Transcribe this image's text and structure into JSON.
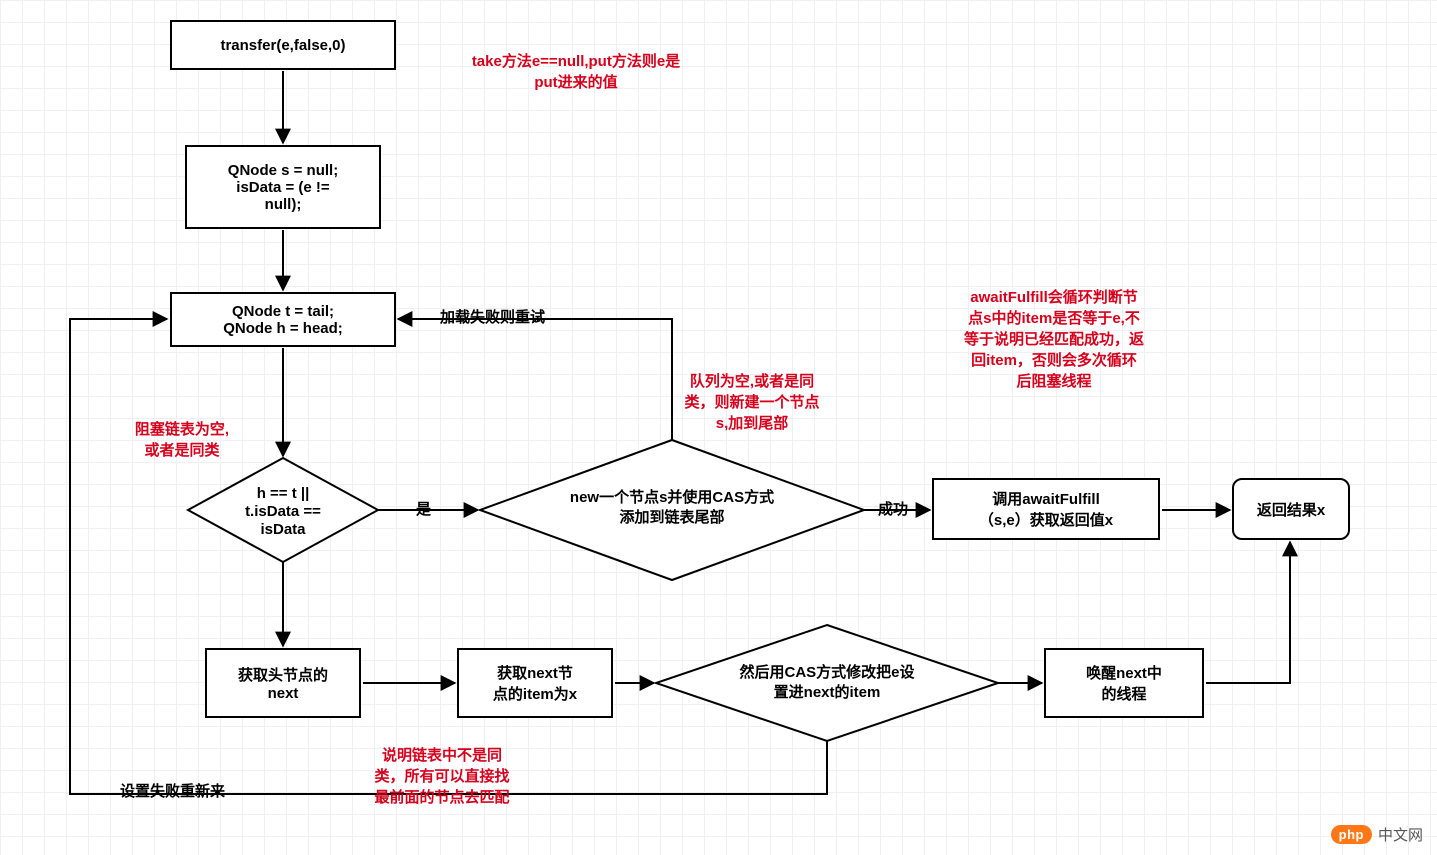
{
  "chart_data": {
    "type": "flowchart",
    "title": "",
    "nodes": [
      {
        "id": "n_start",
        "shape": "rect",
        "text": "transfer(e,false,0)"
      },
      {
        "id": "n_init",
        "shape": "rect",
        "text": "QNode s = null;\nisData = (e !=\nnull);"
      },
      {
        "id": "n_loop",
        "shape": "rect",
        "text": "QNode t = tail;\nQNode h = head;"
      },
      {
        "id": "d_cond",
        "shape": "diamond",
        "text": "h == t ||\nt.isData ==\nisData"
      },
      {
        "id": "d_new",
        "shape": "diamond",
        "text": "new一个节点s并使用CAS方式\n添加到链表尾部"
      },
      {
        "id": "n_await",
        "shape": "rect",
        "text": "调用awaitFulfill\n（s,e）获取返回值x"
      },
      {
        "id": "n_return",
        "shape": "round",
        "text": "返回结果x"
      },
      {
        "id": "n_gethead",
        "shape": "rect",
        "text": "获取头节点的\nnext"
      },
      {
        "id": "n_getitem",
        "shape": "rect",
        "text": "获取next节\n点的item为x"
      },
      {
        "id": "d_casset",
        "shape": "diamond",
        "text": "然后用CAS方式修改把e设\n置进next的item"
      },
      {
        "id": "n_wake",
        "shape": "rect",
        "text": "唤醒next中\n的线程"
      }
    ],
    "edges": [
      {
        "from": "n_start",
        "to": "n_init",
        "label": ""
      },
      {
        "from": "n_init",
        "to": "n_loop",
        "label": ""
      },
      {
        "from": "n_loop",
        "to": "d_cond",
        "label": ""
      },
      {
        "from": "d_cond",
        "to": "d_new",
        "label": "是"
      },
      {
        "from": "d_new",
        "to": "n_await",
        "label": "成功"
      },
      {
        "from": "n_await",
        "to": "n_return",
        "label": ""
      },
      {
        "from": "d_new",
        "to": "n_loop",
        "label": "加载失败则重试"
      },
      {
        "from": "d_cond",
        "to": "n_gethead",
        "label": ""
      },
      {
        "from": "n_gethead",
        "to": "n_getitem",
        "label": ""
      },
      {
        "from": "n_getitem",
        "to": "d_casset",
        "label": ""
      },
      {
        "from": "d_casset",
        "to": "n_wake",
        "label": ""
      },
      {
        "from": "n_wake",
        "to": "n_return",
        "label": ""
      },
      {
        "from": "d_casset",
        "to": "n_loop",
        "label": "设置失败重新来"
      }
    ],
    "annotations": [
      {
        "id": "a_take",
        "text": "take方法e==null,put方法则e是\nput进来的值"
      },
      {
        "id": "a_empty",
        "text": "阻塞链表为空,\n或者是同类"
      },
      {
        "id": "a_queue",
        "text": "队列为空,或者是同\n类，则新建一个节点\ns,加到尾部"
      },
      {
        "id": "a_await",
        "text": "awaitFulfill会循环判断节\n点s中的item是否等于e,不\n等于说明已经匹配成功，返\n回item，否则会多次循环\n后阻塞线程"
      },
      {
        "id": "a_explain",
        "text": "说明链表中不是同\n类，所有可以直接找\n最前面的节点去匹配"
      }
    ]
  },
  "edge_labels": {
    "yes": "是",
    "success": "成功",
    "retry_load": "加载失败则重试",
    "retry_set": "设置失败重新来"
  },
  "watermark": {
    "pill": "php",
    "text": "中文网"
  }
}
